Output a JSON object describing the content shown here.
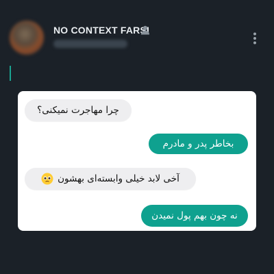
{
  "post_header": {
    "account_name": "NO CONTEXT FARSI",
    "icons": {
      "person": "person-icon",
      "more": "more-options-icon"
    }
  },
  "chat": {
    "messages": [
      {
        "side": "incoming",
        "text": "چرا مهاجرت نمیکنی؟"
      },
      {
        "side": "outgoing",
        "text": "بخاطر پدر و مادرم"
      },
      {
        "side": "incoming",
        "text": "آخی لابد خیلی وابسته‌ای بهشون",
        "emoji": "pleading-face"
      },
      {
        "side": "outgoing",
        "text": "نه چون بهم پول نمیدن"
      }
    ]
  },
  "colors": {
    "background": "#1b2128",
    "accent": "#1aa592",
    "outgoing_bubble": "#0fa18f",
    "incoming_bubble": "#eeeef0",
    "card": "#ffffff"
  }
}
